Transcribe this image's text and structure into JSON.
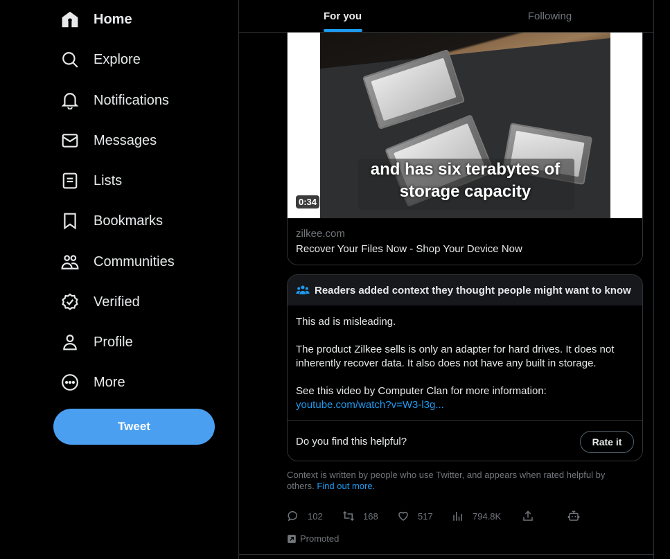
{
  "sidebar": {
    "items": [
      {
        "label": "Home",
        "icon": "home-icon"
      },
      {
        "label": "Explore",
        "icon": "search-icon"
      },
      {
        "label": "Notifications",
        "icon": "bell-icon"
      },
      {
        "label": "Messages",
        "icon": "envelope-icon"
      },
      {
        "label": "Lists",
        "icon": "list-icon"
      },
      {
        "label": "Bookmarks",
        "icon": "bookmark-icon"
      },
      {
        "label": "Communities",
        "icon": "communities-icon"
      },
      {
        "label": "Verified",
        "icon": "verified-icon"
      },
      {
        "label": "Profile",
        "icon": "person-icon"
      },
      {
        "label": "More",
        "icon": "more-circle-icon"
      }
    ],
    "tweet_label": "Tweet"
  },
  "tabs": [
    {
      "label": "For you",
      "active": true
    },
    {
      "label": "Following",
      "active": false
    }
  ],
  "card": {
    "video_caption_line1": "and has six terabytes of",
    "video_caption_line2": "storage capacity",
    "duration": "0:34",
    "domain": "zilkee.com",
    "title": "Recover Your Files Now - Shop Your Device Now"
  },
  "note": {
    "header": "Readers added context they thought people might want to know",
    "p1": "This ad is misleading.",
    "p2": "The product Zilkee sells is only an adapter for hard drives. It does not inherently recover data. It also does not have any built in storage.",
    "p3": "See this video by Computer Clan for more information:",
    "link": "youtube.com/watch?v=W3-l3g...",
    "question": "Do you find this helpful?",
    "rate_label": "Rate it"
  },
  "context": {
    "text": "Context is written by people who use Twitter, and appears when rated helpful by others.",
    "link": "Find out more."
  },
  "actions": {
    "replies": "102",
    "retweets": "168",
    "likes": "517",
    "views": "794.8K"
  },
  "promoted": "Promoted",
  "colors": {
    "accent": "#1d9bf0",
    "tweet_button": "#4a9ff0",
    "muted": "#71767b",
    "border": "#2f3336"
  }
}
